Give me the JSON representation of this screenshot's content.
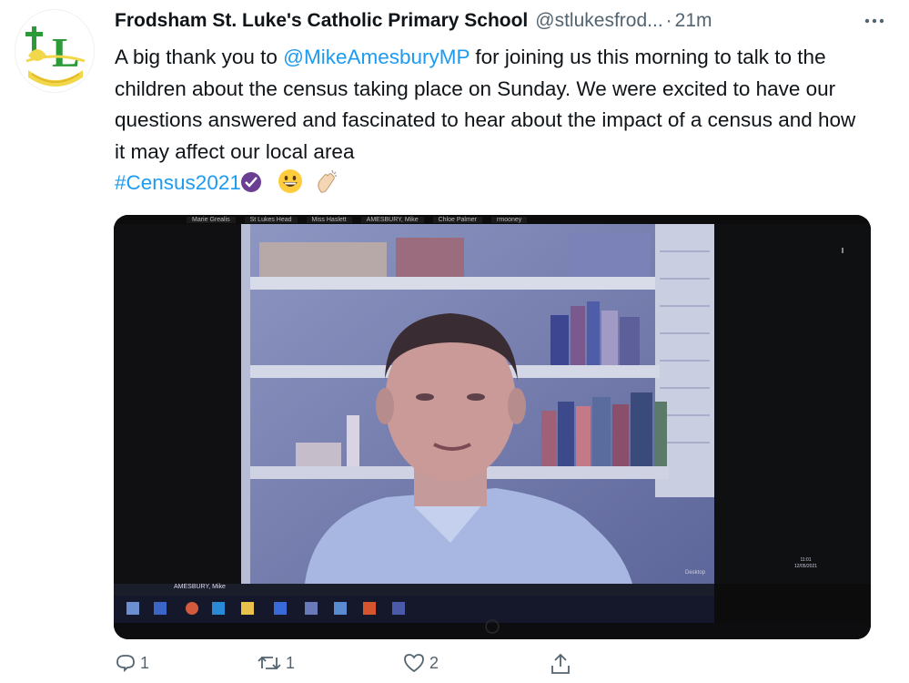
{
  "tweet": {
    "author_name": "Frodsham St. Luke's Catholic Primary School",
    "handle": "@stlukesfrod...",
    "separator": "·",
    "time": "21m",
    "avatar_icon": "school-crest-icon",
    "text_part1": "A big thank you to ",
    "mention": "@MikeAmesburyMP",
    "text_part2": " for joining us this morning to talk to the children about the census taking place on Sunday. We were excited to have our questions answered and fascinated to hear about the impact of a census and how it may affect our local area",
    "hashtag": "#Census2021"
  },
  "media": {
    "participants": [
      "Marie Grealis",
      "St Lukes Head",
      "Miss Haslett",
      "AMESBURY, Mike",
      "Chloe Palmer",
      "rmooney"
    ],
    "speaker_label": "AMESBURY, Mike",
    "desktop_label": "Desktop",
    "clock_time": "11:01",
    "clock_date": "12/05/2021"
  },
  "actions": {
    "reply_count": "1",
    "retweet_count": "1",
    "like_count": "2"
  },
  "colors": {
    "link": "#1d9bf0",
    "secondary_text": "#536471",
    "census_badge": "#6a3f93"
  }
}
